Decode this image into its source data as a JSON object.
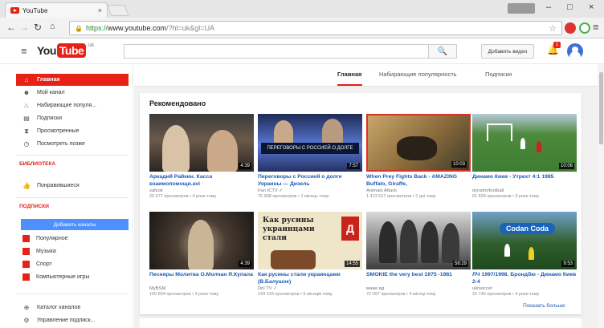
{
  "browser": {
    "tab_title": "YouTube",
    "tab_close": "×",
    "url_https": "https://",
    "url_host": "www.youtube.com",
    "url_query": "/?hl=uk&gl=UA",
    "win_min": "–",
    "win_max": "□",
    "win_close": "×"
  },
  "masthead": {
    "logo_you": "You",
    "logo_tube": "Tube",
    "logo_region": "UA",
    "search_placeholder": "",
    "upload_label": "Добавить видео",
    "notification_count": "1"
  },
  "sidebar": {
    "nav": [
      {
        "label": "Главная",
        "icon": "home-icon",
        "glyph": "⌂"
      },
      {
        "label": "Мой канал",
        "icon": "user-icon",
        "glyph": "☻"
      },
      {
        "label": "Набирающие популя...",
        "icon": "trending-icon",
        "glyph": "♨"
      },
      {
        "label": "Подписки",
        "icon": "subscriptions-icon",
        "glyph": "▤"
      },
      {
        "label": "Просмотренные",
        "icon": "history-icon",
        "glyph": "⧗"
      },
      {
        "label": "Посмотреть позже",
        "icon": "watch-later-icon",
        "glyph": "◷"
      }
    ],
    "library_heading": "БИБЛИОТЕКА",
    "library": [
      {
        "label": "Понравившиеся",
        "icon": "like-icon",
        "glyph": "👍"
      }
    ],
    "subscriptions_heading": "ПОДПИСКИ",
    "add_channels_label": "Добавить каналы",
    "subscriptions": [
      {
        "label": "Популярное"
      },
      {
        "label": "Музыка"
      },
      {
        "label": "Спорт"
      },
      {
        "label": "Компьютерные игры"
      }
    ],
    "footer": [
      {
        "label": "Каталог каналов",
        "icon": "catalog-icon",
        "glyph": "⊕"
      },
      {
        "label": "Управление подписк...",
        "icon": "settings-icon",
        "glyph": "⚙"
      }
    ]
  },
  "content_tabs": [
    "Главная",
    "Набирающие популярность",
    "Подписки"
  ],
  "recommended": {
    "title": "Рекомендовано",
    "show_more": "Показать больше",
    "videos": [
      {
        "title": "Аркадий Райкин. Касса взаимопомощи.avi",
        "channel": "safzoir",
        "views": "29 677 просмотров",
        "age": "4 роки тому",
        "duration": "4:39"
      },
      {
        "title": "Переговоры с Россией о долге Украины — Дизель",
        "channel": "Fun ICTV ✓",
        "views": "75 968 просмотров",
        "age": "1 місяць тому",
        "duration": "7:57",
        "banner": "ПЕРЕГОВОРЫ С РОССИЕЙ О ДОЛГЕ"
      },
      {
        "title": "When Prey Fights Back - AMAZING Buffalo, Giraffe,",
        "channel": "Animals Attack",
        "views": "1 413 517 просмотров",
        "age": "2 дні тому",
        "duration": "10:03"
      },
      {
        "title": "Динамо Киев - Утрехт 4:1 1985",
        "channel": "dynamofootball",
        "views": "61 839 просмотров",
        "age": "3 роки тому",
        "duration": "10:06"
      },
      {
        "title": "Песняры Молитва О.Молчан Я.Купала",
        "channel": "MyBSM",
        "views": "100 834 просмотров",
        "age": "3 роки тому",
        "duration": "4:39"
      },
      {
        "title": "Как русины стали украинцами (В.Балушок)",
        "channel": "Dni TV ✓",
        "views": "143 315 просмотров",
        "age": "5 місяців тому",
        "duration": "14:55",
        "poster_text": "Как русины украинцами стали",
        "poster_badge": "Д"
      },
      {
        "title": "SMOKIE the very best 1975 -1981",
        "channel": "маже вд",
        "views": "72 097 просмотров",
        "age": "4 місяці тому",
        "duration": "58:29"
      },
      {
        "title": "ЛЧ 1997/1998. Брондбю - Динамо Киев 2-4",
        "channel": "ukrsoccer",
        "views": "22 746 просмотров",
        "age": "4 роки тому",
        "duration": "9:53",
        "ad_text": "Codan Coda"
      }
    ]
  },
  "colors": {
    "brand_red": "#e62117",
    "link_blue": "#1a5ab4",
    "button_blue": "#4d90fe"
  }
}
